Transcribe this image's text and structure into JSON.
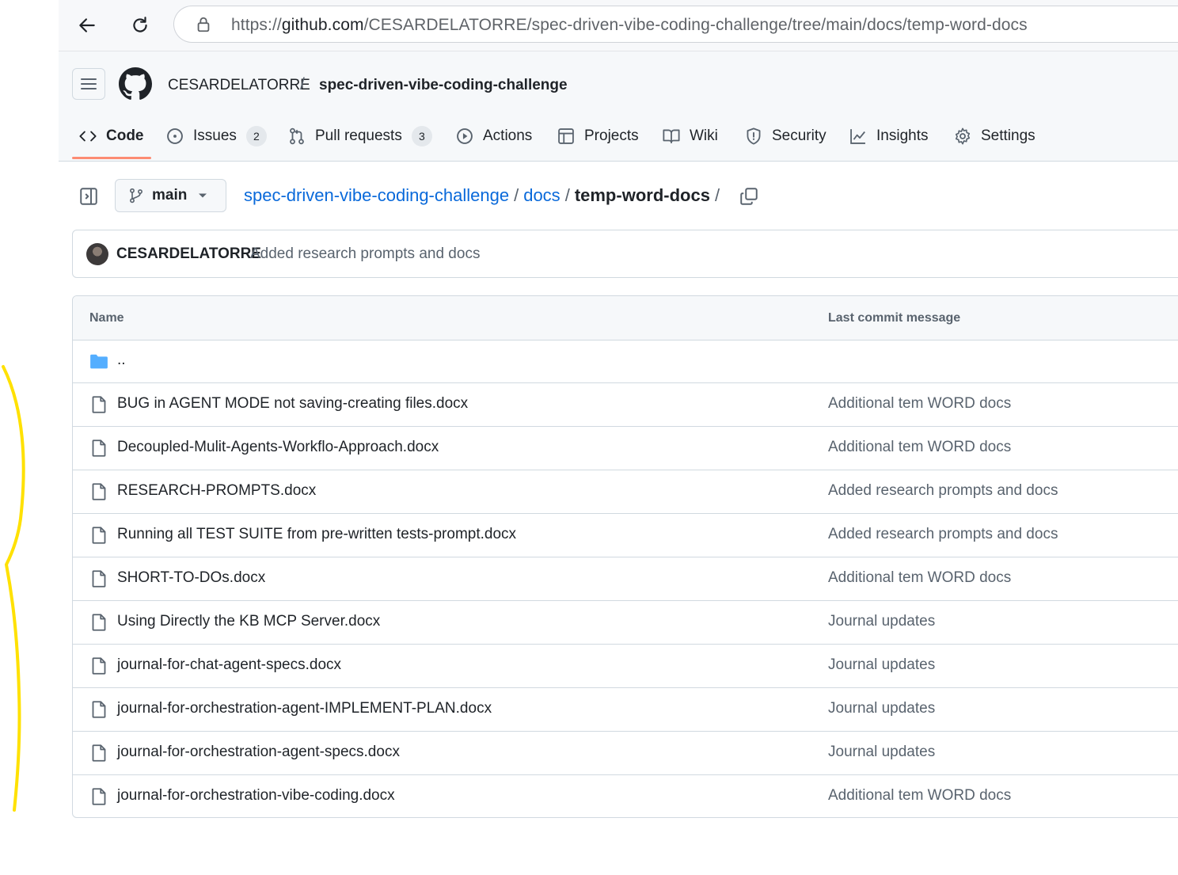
{
  "browser": {
    "url_prefix": "https://",
    "url_domain": "github.com",
    "url_path": "/CESARDELATORRE/spec-driven-vibe-coding-challenge/tree/main/docs/temp-word-docs",
    "back_icon": "arrow-left-icon",
    "reload_icon": "reload-icon",
    "site_info_icon": "lock-icon"
  },
  "header": {
    "owner": "CESARDELATORRE",
    "separator": "/",
    "repo": "spec-driven-vibe-coding-challenge",
    "tabs": [
      {
        "label": "Code",
        "icon": "code-icon",
        "active": true
      },
      {
        "label": "Issues",
        "icon": "issue-icon",
        "count": "2"
      },
      {
        "label": "Pull requests",
        "icon": "pull-request-icon",
        "count": "3"
      },
      {
        "label": "Actions",
        "icon": "play-icon"
      },
      {
        "label": "Projects",
        "icon": "table-icon"
      },
      {
        "label": "Wiki",
        "icon": "book-icon"
      },
      {
        "label": "Security",
        "icon": "shield-icon"
      },
      {
        "label": "Insights",
        "icon": "graph-icon"
      },
      {
        "label": "Settings",
        "icon": "gear-icon"
      }
    ],
    "accent_color": "#fd8c73"
  },
  "repo_nav": {
    "branch": "main",
    "breadcrumb": {
      "root": "spec-driven-vibe-coding-challenge",
      "folder": "docs",
      "current": "temp-word-docs",
      "sep": "/"
    }
  },
  "latest_commit": {
    "author": "CESARDELATORRE",
    "message": "Added research prompts and docs"
  },
  "file_table": {
    "columns": [
      "Name",
      "Last commit message"
    ],
    "parent": "..",
    "files": [
      {
        "name": "BUG in AGENT MODE not saving-creating files.docx",
        "commit": "Additional tem WORD docs"
      },
      {
        "name": "Decoupled-Mulit-Agents-Workflo-Approach.docx",
        "commit": "Additional tem WORD docs"
      },
      {
        "name": "RESEARCH-PROMPTS.docx",
        "commit": "Added research prompts and docs"
      },
      {
        "name": "Running all TEST SUITE from pre-written tests-prompt.docx",
        "commit": "Added research prompts and docs"
      },
      {
        "name": "SHORT-TO-DOs.docx",
        "commit": "Additional tem WORD docs"
      },
      {
        "name": "Using Directly the KB MCP Server.docx",
        "commit": "Journal updates"
      },
      {
        "name": "journal-for-chat-agent-specs.docx",
        "commit": "Journal updates"
      },
      {
        "name": "journal-for-orchestration-agent-IMPLEMENT-PLAN.docx",
        "commit": "Journal updates"
      },
      {
        "name": "journal-for-orchestration-agent-specs.docx",
        "commit": "Journal updates"
      },
      {
        "name": "journal-for-orchestration-vibe-coding.docx",
        "commit": "Additional tem WORD docs"
      }
    ]
  },
  "colors": {
    "link": "#0969da",
    "folder_icon": "#54aeff",
    "annotation": "#ffe100"
  }
}
